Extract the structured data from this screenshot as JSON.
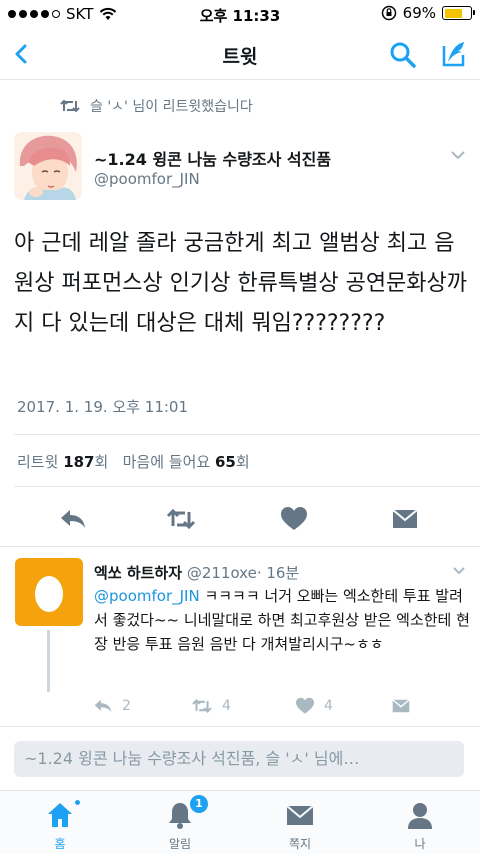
{
  "status_bar": {
    "carrier": "SKT",
    "time": "오후 11:33",
    "battery": "69%",
    "battery_level": 0.69
  },
  "nav": {
    "title": "트윗"
  },
  "retweet_context": "슬 'ㅅ' 님이 리트윗했습니다",
  "tweet": {
    "author_name": "~1.24 윙콘 나눔 수량조사 석진품",
    "author_handle": "@poomfor_JIN",
    "text": "아 근데 레알 졸라 궁금한게 최고 앨범상 최고 음원상 퍼포먼스상 인기상 한류특별상 공연문화상까지 다 있는데 대상은 대체 뭐임????????",
    "timestamp": "2017. 1. 19. 오후 11:01",
    "stats": {
      "retweet_label": "리트윗",
      "retweet_count": "187",
      "retweet_unit": "회",
      "like_label": "마음에 들어요",
      "like_count": "65",
      "like_unit": "회"
    }
  },
  "reply": {
    "author_name": "엑쏘 하트하자",
    "author_handle": "@211oxe",
    "time": "· 16분",
    "mention": "@poomfor_JIN",
    "text": " ㅋㅋㅋㅋ 너거 오빠는 엑소한테 투표 발려서 좋겄다~~ 니네말대로 하면 최고후원상 받은 엑소한테 현장 반응 투표 음원 음반 다 개쳐발리시구~ㅎㅎ",
    "reply_count": "2",
    "retweet_count": "4",
    "like_count": "4"
  },
  "reply_box": {
    "placeholder": "~1.24 윙콘 나눔 수량조사 석진품, 슬 'ㅅ' 님에…"
  },
  "tabs": [
    {
      "label": "홈"
    },
    {
      "label": "알림",
      "badge": "1"
    },
    {
      "label": "쪽지"
    },
    {
      "label": "나"
    }
  ],
  "colors": {
    "accent": "#1da1f2",
    "icon_gray": "#657786",
    "egg_avatar": "#f4a30c"
  }
}
